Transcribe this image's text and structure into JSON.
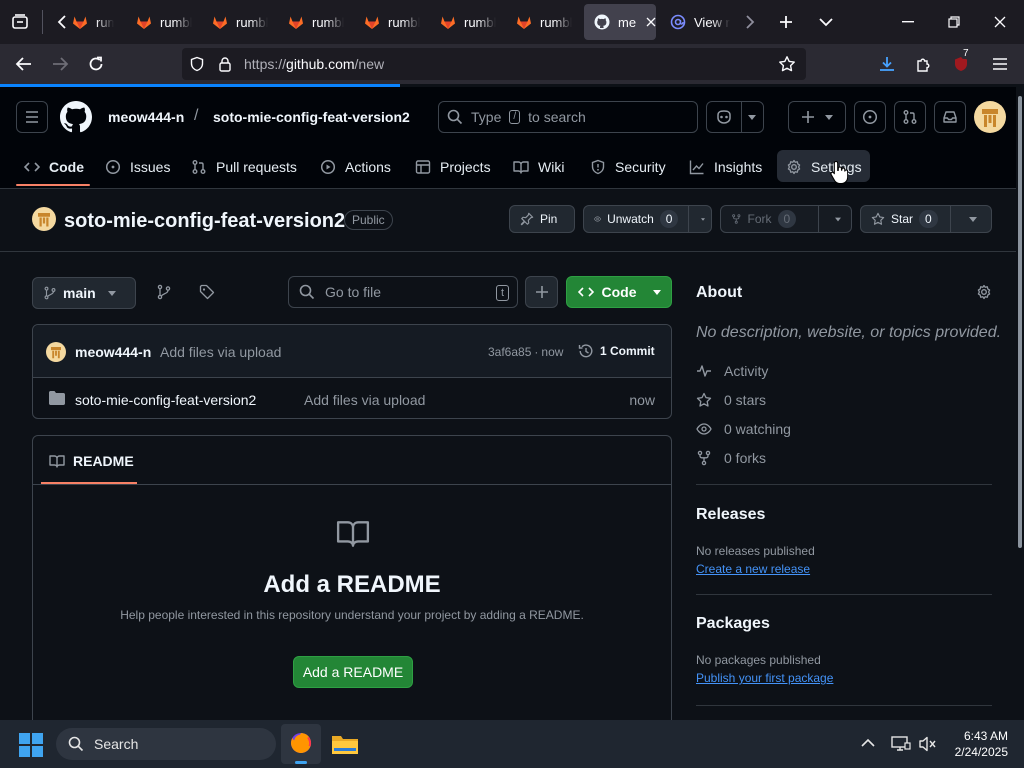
{
  "browser": {
    "tabs": [
      {
        "label": "rumbl",
        "icon": "gitlab-icon"
      },
      {
        "label": "rumbl",
        "icon": "gitlab-icon"
      },
      {
        "label": "rumbl",
        "icon": "gitlab-icon"
      },
      {
        "label": "rumbl",
        "icon": "gitlab-icon"
      },
      {
        "label": "rumbl",
        "icon": "gitlab-icon"
      },
      {
        "label": "rumbl",
        "icon": "gitlab-icon"
      },
      {
        "label": "rumbl",
        "icon": "gitlab-icon"
      },
      {
        "label": "me",
        "icon": "github-icon",
        "active": true
      },
      {
        "label": "View r",
        "icon": "at-sign-icon"
      }
    ],
    "url_prefix": "https://",
    "url_host": "github.com",
    "url_path": "/new",
    "extension_badge": "7",
    "accent": "#0a84ff"
  },
  "header": {
    "owner": "meow444-n",
    "separator": "/",
    "repo": "soto-mie-config-feat-version2",
    "search_pre": "Type",
    "search_key": "/",
    "search_post": "to search"
  },
  "repo_nav": {
    "code": "Code",
    "issues": "Issues",
    "pulls": "Pull requests",
    "actions": "Actions",
    "projects": "Projects",
    "wiki": "Wiki",
    "security": "Security",
    "insights": "Insights",
    "settings": "Settings"
  },
  "title_row": {
    "repo_name": "soto-mie-config-feat-version2",
    "visibility": "Public",
    "pin": "Pin",
    "unwatch": "Unwatch",
    "unwatch_count": "0",
    "fork": "Fork",
    "fork_count": "0",
    "star": "Star",
    "star_count": "0"
  },
  "toolbar": {
    "branch": "main",
    "goto_placeholder": "Go to file",
    "goto_key": "t",
    "code_button": "Code",
    "code_color": "#238636"
  },
  "commit": {
    "author": "meow444-n",
    "message": "Add files via upload",
    "hash": "3af6a85",
    "dot": "·",
    "time": "now",
    "count": "1 Commit"
  },
  "files": [
    {
      "name": "soto-mie-config-feat-version2",
      "message": "Add files via upload",
      "time": "now",
      "icon": "folder-icon"
    }
  ],
  "readme": {
    "tab": "README",
    "heading": "Add a README",
    "description": "Help people interested in this repository understand your project by adding a README.",
    "button": "Add a README"
  },
  "about": {
    "title": "About",
    "description": "No description, website, or topics provided.",
    "activity": "Activity",
    "stars": "0 stars",
    "watching": "0 watching",
    "forks": "0 forks"
  },
  "releases": {
    "title": "Releases",
    "empty": "No releases published",
    "link": "Create a new release"
  },
  "packages": {
    "title": "Packages",
    "empty": "No packages published",
    "link": "Publish your first package"
  },
  "taskbar": {
    "search": "Search",
    "time": "6:43 AM",
    "date": "2/24/2025"
  }
}
